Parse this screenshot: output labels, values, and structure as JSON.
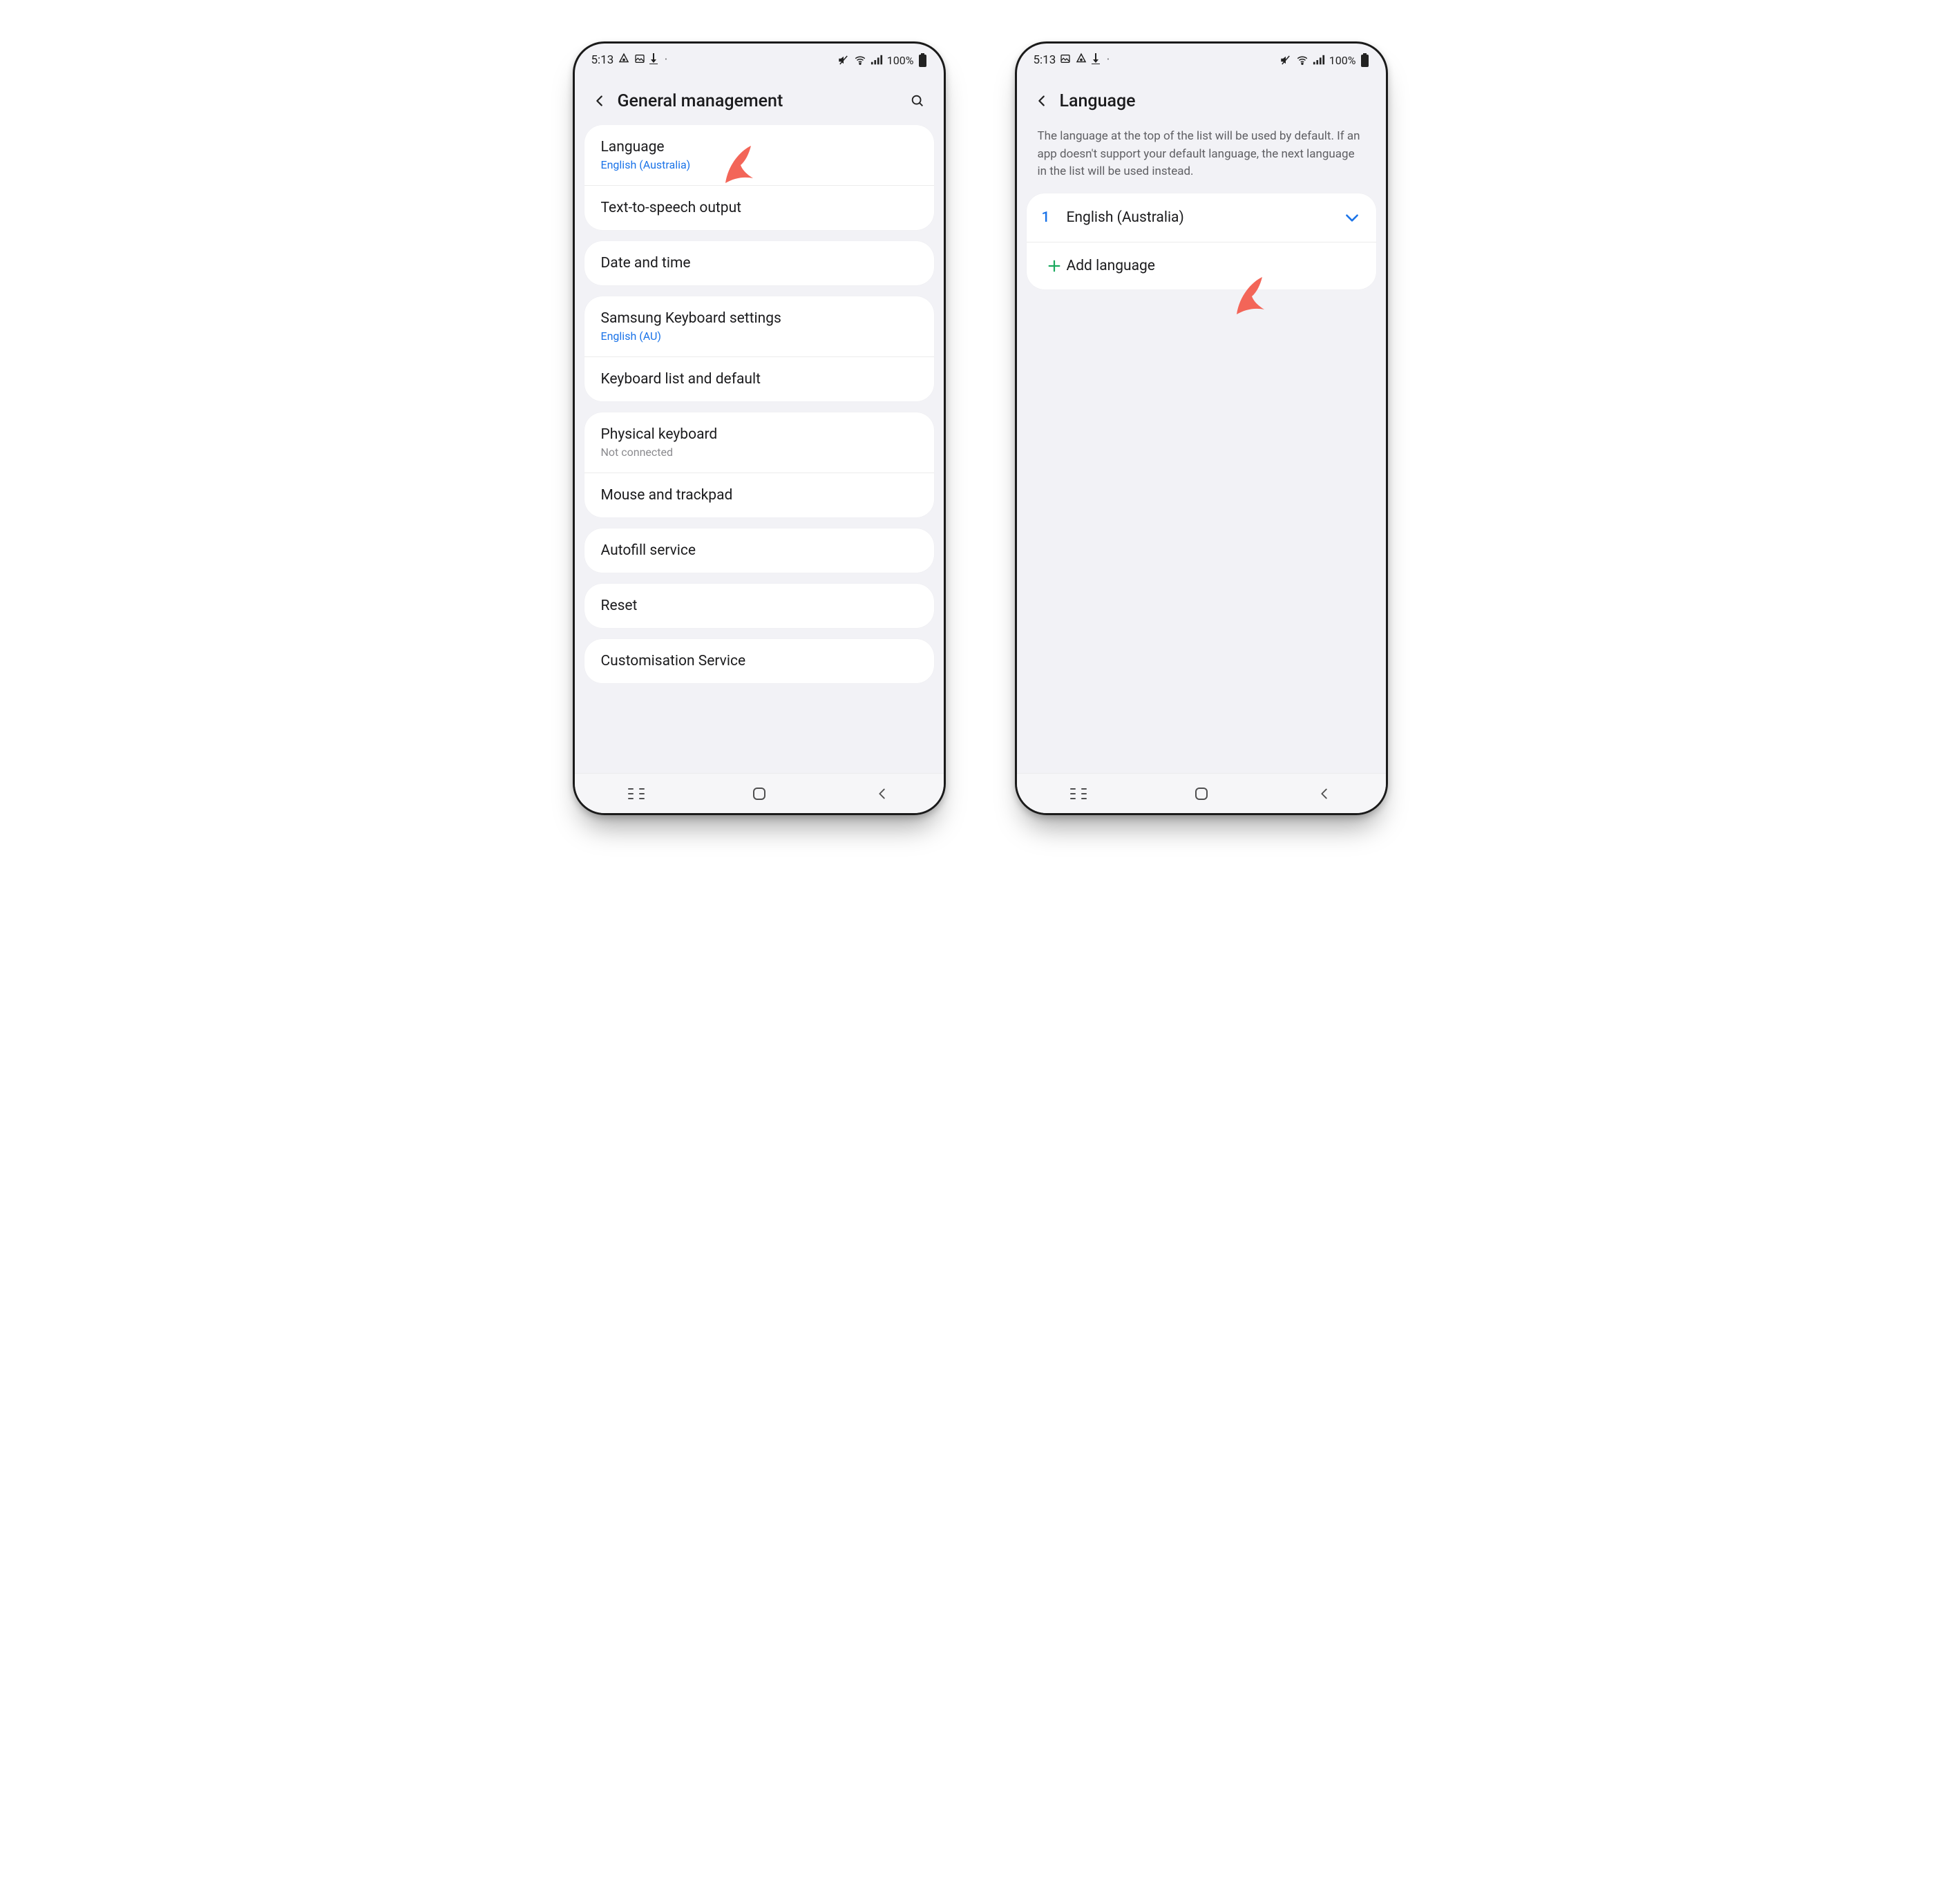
{
  "status": {
    "time": "5:13",
    "battery": "100%"
  },
  "screen1": {
    "title": "General management",
    "groups": [
      {
        "rows": [
          {
            "title": "Language",
            "sub": "English (Australia)",
            "subStyle": "blue"
          },
          {
            "title": "Text-to-speech output"
          }
        ]
      },
      {
        "rows": [
          {
            "title": "Date and time"
          }
        ]
      },
      {
        "rows": [
          {
            "title": "Samsung Keyboard settings",
            "sub": "English (AU)",
            "subStyle": "blue"
          },
          {
            "title": "Keyboard list and default"
          }
        ]
      },
      {
        "rows": [
          {
            "title": "Physical keyboard",
            "sub": "Not connected",
            "subStyle": "muted"
          },
          {
            "title": "Mouse and trackpad"
          }
        ]
      },
      {
        "rows": [
          {
            "title": "Autofill service"
          }
        ]
      },
      {
        "rows": [
          {
            "title": "Reset"
          }
        ]
      },
      {
        "rows": [
          {
            "title": "Customisation Service"
          }
        ]
      }
    ]
  },
  "screen2": {
    "title": "Language",
    "description": "The language at the top of the list will be used by default. If an app doesn't support your default language, the next language in the list will be used instead.",
    "primaryIndex": "1",
    "primaryLabel": "English (Australia)",
    "addLabel": "Add language"
  }
}
